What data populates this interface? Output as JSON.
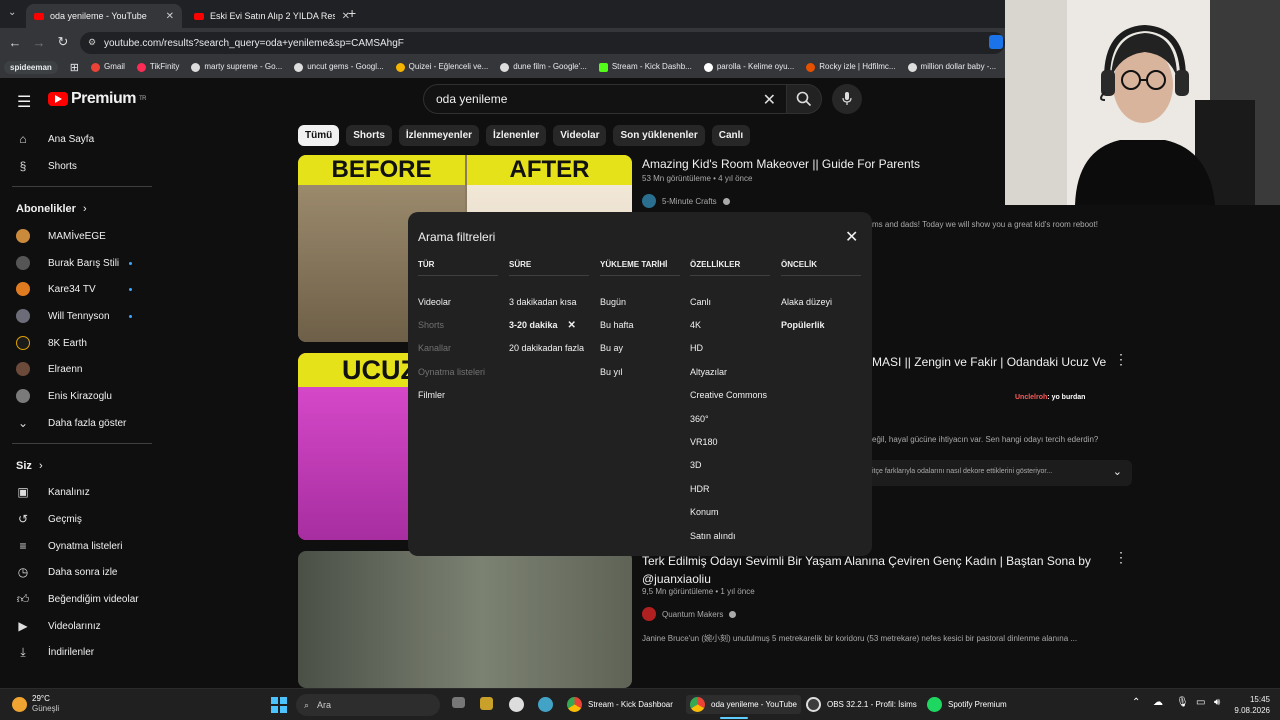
{
  "browser": {
    "tabs": [
      {
        "title": "oda yenileme - YouTube",
        "active": true
      },
      {
        "title": "Eski Evi Satın Alıp 2 YILDA Resto",
        "active": false
      }
    ],
    "new_tab": "+",
    "url": "youtube.com/results?search_query=oda+yenileme&sp=CAMSAhgF",
    "bookmarks": [
      "spideeman",
      "Gmail",
      "TikFinity",
      "marty supreme - Go...",
      "uncut gems - Googl...",
      "Quizei - Eğlenceli ve...",
      "dune film - Google'...",
      "Stream - Kick Dashb...",
      "parolla - Kelime oyu...",
      "Rocky izle | Hdfilmc...",
      "million dollar baby -..."
    ]
  },
  "youtube": {
    "logo": "Premium",
    "logo_sup": "TR",
    "search_value": "oda yenileme",
    "sidebar": {
      "home": "Ana Sayfa",
      "shorts": "Shorts",
      "subs_header": "Abonelikler",
      "subs": [
        "MAMİveEGE",
        "Burak Barış Stili",
        "Kare34 TV",
        "Will Tennyson",
        "8K Earth",
        "Elraenn",
        "Enis Kirazoglu"
      ],
      "show_more": "Daha fazla göster",
      "you_header": "Siz",
      "you_items": [
        "Kanalınız",
        "Geçmiş",
        "Oynatma listeleri",
        "Daha sonra izle",
        "Beğendiğim videolar",
        "Videolarınız",
        "İndirilenler"
      ]
    },
    "chips": [
      "Tümü",
      "Shorts",
      "İzlenmeyenler",
      "İzlenenler",
      "Videolar",
      "Son yüklenenler",
      "Canlı"
    ],
    "results": [
      {
        "title": "Amazing Kid's Room Makeover || Guide For Parents",
        "meta": "53 Mn görüntüleme • 4 yıl önce",
        "channel": "5-Minute Crafts",
        "desc": "ms and dads! Today we will show you a great kid's room reboot!",
        "thumb_left": "BEFORE",
        "thumb_right": "AFTER"
      },
      {
        "title": "MASI || Zengin ve Fakir | Odandaki Ucuz Ve",
        "desc": "eğil, hayal gücüne ihtiyacın var. Sen hangi odayı tercih ederdin?",
        "chapter": "itçe farklarıyla odalarını nasıl dekore ettiklerini gösteriyor...",
        "thumb_text": "UCUZ"
      },
      {
        "title": "Terk Edilmiş Odayı Sevimli Bir Yaşam Alanına Çeviren Genç Kadın | Baştan Sona by @juanxiaoliu",
        "meta": "9,5 Mn görüntüleme • 1 yıl önce",
        "channel": "Quantum Makers",
        "desc": "Janine Bruce'un (婉小刻) unutulmuş 5 metrekarelik bir koridoru (53 metrekare) nefes kesici bir pastoral dinlenme alanına ..."
      }
    ],
    "chat_overlay": {
      "user": "Unclelroh",
      "message": ": yo burdan"
    },
    "filter_modal": {
      "title": "Arama filtreleri",
      "columns": [
        {
          "header": "TÜR",
          "items": [
            {
              "label": "Videolar",
              "state": "normal"
            },
            {
              "label": "Shorts",
              "state": "disabled"
            },
            {
              "label": "Kanallar",
              "state": "disabled"
            },
            {
              "label": "Oynatma listeleri",
              "state": "disabled"
            },
            {
              "label": "Filmler",
              "state": "normal"
            }
          ]
        },
        {
          "header": "SÜRE",
          "items": [
            {
              "label": "3 dakikadan kısa",
              "state": "normal"
            },
            {
              "label": "3-20 dakika",
              "state": "selected"
            },
            {
              "label": "20 dakikadan fazla",
              "state": "normal"
            }
          ]
        },
        {
          "header": "YÜKLEME TARİHİ",
          "items": [
            {
              "label": "Bugün",
              "state": "normal"
            },
            {
              "label": "Bu hafta",
              "state": "normal"
            },
            {
              "label": "Bu ay",
              "state": "normal"
            },
            {
              "label": "Bu yıl",
              "state": "normal"
            }
          ]
        },
        {
          "header": "ÖZELLİKLER",
          "items": [
            {
              "label": "Canlı",
              "state": "normal"
            },
            {
              "label": "4K",
              "state": "normal"
            },
            {
              "label": "HD",
              "state": "normal"
            },
            {
              "label": "Altyazılar",
              "state": "normal"
            },
            {
              "label": "Creative Commons",
              "state": "normal"
            },
            {
              "label": "360°",
              "state": "normal"
            },
            {
              "label": "VR180",
              "state": "normal"
            },
            {
              "label": "3D",
              "state": "normal"
            },
            {
              "label": "HDR",
              "state": "normal"
            },
            {
              "label": "Konum",
              "state": "normal"
            },
            {
              "label": "Satın alındı",
              "state": "normal"
            }
          ]
        },
        {
          "header": "ÖNCELİK",
          "items": [
            {
              "label": "Alaka düzeyi",
              "state": "normal"
            },
            {
              "label": "Popülerlik",
              "state": "selected"
            }
          ]
        }
      ]
    }
  },
  "taskbar": {
    "weather_temp": "29°C",
    "weather_desc": "Güneşli",
    "search": "Ara",
    "apps": [
      "Stream - Kick Dashboar",
      "oda yenileme - YouTube",
      "OBS 32.2.1 - Profil: İsims",
      "Spotify Premium"
    ],
    "time": "15:45",
    "date": "9.08.2026"
  },
  "colors": {
    "accent_red": "#ff0000",
    "bg": "#0f0f0f",
    "chip_bg": "#272727",
    "modal_bg": "#212121",
    "live_blue": "#3ea6ff"
  }
}
